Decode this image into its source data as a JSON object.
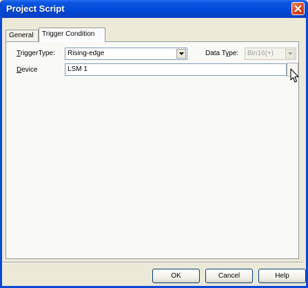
{
  "window": {
    "title": "Project Script"
  },
  "tabs": [
    {
      "label": "General",
      "selected": false
    },
    {
      "label": "Trigger Condition",
      "selected": true
    }
  ],
  "trigger_type": {
    "label_mnemonic": "T",
    "label_rest": "riggerType:",
    "value": "Rising-edge"
  },
  "data_type": {
    "label_pre": "Data T",
    "label_mnemonic": "y",
    "label_post": "pe:",
    "value": "Bin16(+)",
    "disabled": true
  },
  "device": {
    "label_mnemonic": "D",
    "label_rest": "evice",
    "value": "LSM 1"
  },
  "buttons": {
    "ok": "OK",
    "cancel": "Cancel",
    "help": "Help"
  },
  "colors": {
    "titlebar": "#0048d8",
    "window_bg": "#ece9d8",
    "close": "#d8431a"
  },
  "icons": [
    "close-icon",
    "dropdown-arrow-icon",
    "mouse-cursor-icon"
  ]
}
